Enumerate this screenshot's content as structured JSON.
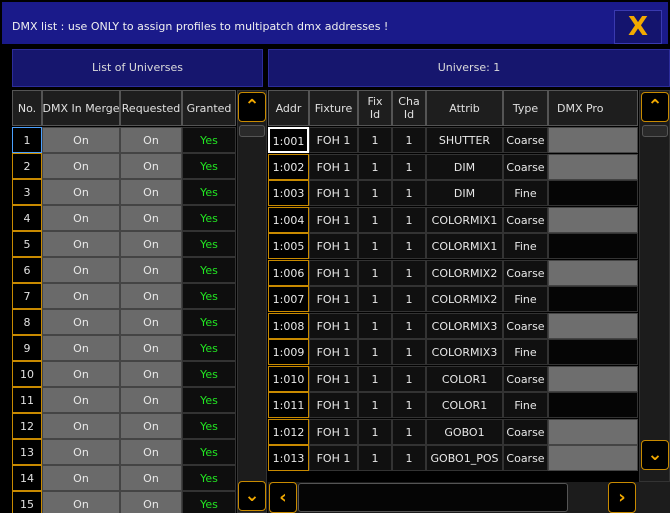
{
  "window": {
    "title": "DMX list : use ONLY to assign profiles to multipatch dmx addresses !",
    "close_symbol": "X",
    "close_icon": "close-icon"
  },
  "left_panel": {
    "title": "List of Universes",
    "columns": [
      "No.",
      "DMX In Merge",
      "Requested",
      "Granted"
    ],
    "rows": [
      {
        "no": "1",
        "merge": "On",
        "requested": "On",
        "granted": "Yes"
      },
      {
        "no": "2",
        "merge": "On",
        "requested": "On",
        "granted": "Yes"
      },
      {
        "no": "3",
        "merge": "On",
        "requested": "On",
        "granted": "Yes"
      },
      {
        "no": "4",
        "merge": "On",
        "requested": "On",
        "granted": "Yes"
      },
      {
        "no": "5",
        "merge": "On",
        "requested": "On",
        "granted": "Yes"
      },
      {
        "no": "6",
        "merge": "On",
        "requested": "On",
        "granted": "Yes"
      },
      {
        "no": "7",
        "merge": "On",
        "requested": "On",
        "granted": "Yes"
      },
      {
        "no": "8",
        "merge": "On",
        "requested": "On",
        "granted": "Yes"
      },
      {
        "no": "9",
        "merge": "On",
        "requested": "On",
        "granted": "Yes"
      },
      {
        "no": "10",
        "merge": "On",
        "requested": "On",
        "granted": "Yes"
      },
      {
        "no": "11",
        "merge": "On",
        "requested": "On",
        "granted": "Yes"
      },
      {
        "no": "12",
        "merge": "On",
        "requested": "On",
        "granted": "Yes"
      },
      {
        "no": "13",
        "merge": "On",
        "requested": "On",
        "granted": "Yes"
      },
      {
        "no": "14",
        "merge": "On",
        "requested": "On",
        "granted": "Yes"
      },
      {
        "no": "15",
        "merge": "On",
        "requested": "On",
        "granted": "Yes"
      }
    ]
  },
  "right_panel": {
    "title": "Universe: 1",
    "columns": [
      "Addr",
      "Fixture",
      "Fix Id",
      "Cha Id",
      "Attrib",
      "Type",
      "DMX Pro"
    ],
    "rows": [
      {
        "addr": "1:001",
        "fixture": "FOH 1",
        "fix_id": "1",
        "cha_id": "1",
        "attrib": "SHUTTER",
        "type": "Coarse",
        "pro": "grey"
      },
      {
        "addr": "1:002",
        "fixture": "FOH 1",
        "fix_id": "1",
        "cha_id": "1",
        "attrib": "DIM",
        "type": "Coarse",
        "pro": "grey"
      },
      {
        "addr": "1:003",
        "fixture": "FOH 1",
        "fix_id": "1",
        "cha_id": "1",
        "attrib": "DIM",
        "type": "Fine",
        "pro": "dark"
      },
      {
        "addr": "1:004",
        "fixture": "FOH 1",
        "fix_id": "1",
        "cha_id": "1",
        "attrib": "COLORMIX1",
        "type": "Coarse",
        "pro": "grey"
      },
      {
        "addr": "1:005",
        "fixture": "FOH 1",
        "fix_id": "1",
        "cha_id": "1",
        "attrib": "COLORMIX1",
        "type": "Fine",
        "pro": "dark"
      },
      {
        "addr": "1:006",
        "fixture": "FOH 1",
        "fix_id": "1",
        "cha_id": "1",
        "attrib": "COLORMIX2",
        "type": "Coarse",
        "pro": "grey"
      },
      {
        "addr": "1:007",
        "fixture": "FOH 1",
        "fix_id": "1",
        "cha_id": "1",
        "attrib": "COLORMIX2",
        "type": "Fine",
        "pro": "dark"
      },
      {
        "addr": "1:008",
        "fixture": "FOH 1",
        "fix_id": "1",
        "cha_id": "1",
        "attrib": "COLORMIX3",
        "type": "Coarse",
        "pro": "grey"
      },
      {
        "addr": "1:009",
        "fixture": "FOH 1",
        "fix_id": "1",
        "cha_id": "1",
        "attrib": "COLORMIX3",
        "type": "Fine",
        "pro": "dark"
      },
      {
        "addr": "1:010",
        "fixture": "FOH 1",
        "fix_id": "1",
        "cha_id": "1",
        "attrib": "COLOR1",
        "type": "Coarse",
        "pro": "grey"
      },
      {
        "addr": "1:011",
        "fixture": "FOH 1",
        "fix_id": "1",
        "cha_id": "1",
        "attrib": "COLOR1",
        "type": "Fine",
        "pro": "dark"
      },
      {
        "addr": "1:012",
        "fixture": "FOH 1",
        "fix_id": "1",
        "cha_id": "1",
        "attrib": "GOBO1",
        "type": "Coarse",
        "pro": "grey"
      },
      {
        "addr": "1:013",
        "fixture": "FOH 1",
        "fix_id": "1",
        "cha_id": "1",
        "attrib": "GOBO1_POS",
        "type": "Coarse",
        "pro": "grey"
      }
    ]
  },
  "scroll": {
    "up_symbol": "⌃",
    "down_symbol": "⌄",
    "left_symbol": "‹",
    "right_symbol": "›"
  },
  "colors": {
    "title_bar": "#1a1a8a",
    "accent": "#f2a900",
    "granted_text": "#22e622",
    "grey_cell": "#6a6a6a"
  }
}
